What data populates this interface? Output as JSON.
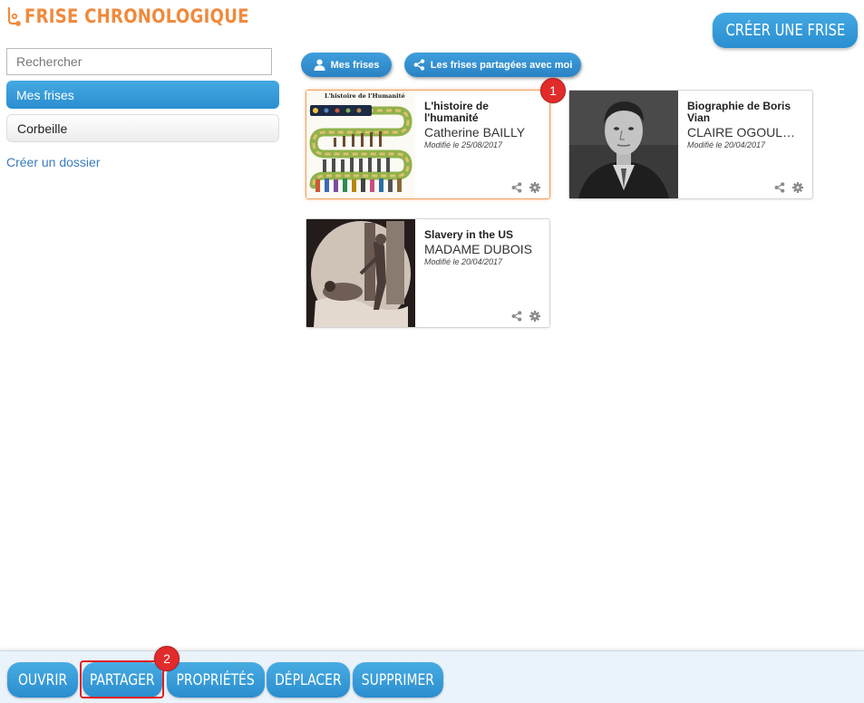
{
  "app": {
    "title": "FRISE CHRONOLOGIQUE",
    "create_button": "CRÉER UNE FRISE",
    "accent": "#2a8ed0",
    "logo_color": "#f08a3c"
  },
  "sidebar": {
    "search_placeholder": "Rechercher",
    "items": [
      {
        "label": "Mes frises",
        "active": true
      },
      {
        "label": "Corbeille",
        "active": false
      }
    ],
    "create_folder": "Créer un dossier"
  },
  "tabs": [
    {
      "label": "Mes frises",
      "icon": "user-icon"
    },
    {
      "label": "Les frises partagées avec moi",
      "icon": "share-icon"
    }
  ],
  "cards": [
    {
      "title": "L'histoire de l'humanité",
      "author": "Catherine BAILLY",
      "date": "Modifié le 25/08/2017",
      "thumb_caption": "L'histoire de l'Humanité",
      "selected": true
    },
    {
      "title": "Biographie de Boris Vian",
      "author": "CLAIRE OGOULADJI",
      "date": "Modifié le 20/04/2017",
      "selected": false
    },
    {
      "title": "Slavery in the US",
      "author": "MADAME DUBOIS",
      "date": "Modifié le 20/04/2017",
      "selected": false
    }
  ],
  "badges": [
    "1",
    "2"
  ],
  "toolbar": {
    "open": "OUVRIR",
    "share": "PARTAGER",
    "properties": "PROPRIÉTÉS",
    "move": "DÉPLACER",
    "delete": "SUPPRIMER"
  }
}
